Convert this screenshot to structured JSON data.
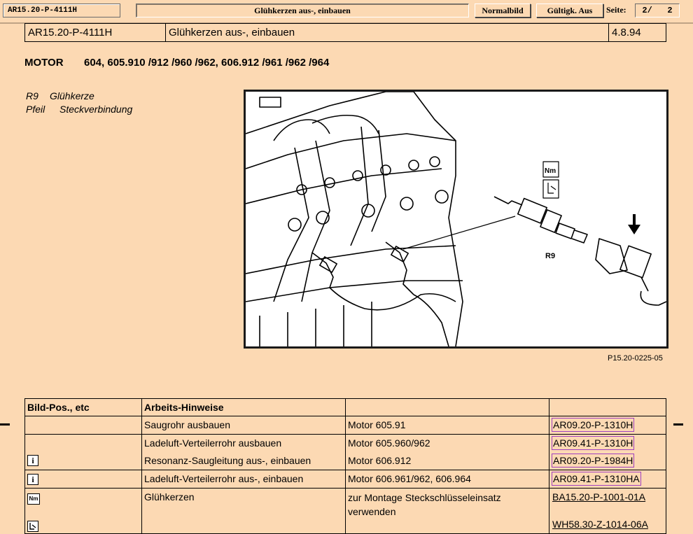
{
  "toolbar": {
    "doc_code": "AR15.20-P-4111H",
    "title": "Glühkerzen aus-, einbauen",
    "normal_button": "Normalbild",
    "validity_button": "Gültigk. Aus",
    "page_label": "Seite:",
    "page_current": "2/",
    "page_total": "2"
  },
  "header": {
    "code": "AR15.20-P-4111H",
    "title": "Glühkerzen aus-, einbauen",
    "date": "4.8.94"
  },
  "motor": {
    "label": "MOTOR",
    "models": "604, 605.910 /912 /960 /962, 606.912 /961 /962 /964"
  },
  "legend": [
    {
      "key": "R9",
      "text": "Glühkerze"
    },
    {
      "key": "Pfeil",
      "text": "Steckverbindung"
    }
  ],
  "figure": {
    "callout": "R9",
    "nm_icon": "Nm",
    "reference": "P15.20-0225-05"
  },
  "table": {
    "headers": [
      "Bild-Pos., etc",
      "Arbeits-Hinweise",
      "",
      ""
    ],
    "rows": [
      {
        "icon": "",
        "task": "Saugrohr ausbauen",
        "cond": "Motor 605.91",
        "ref": "AR09.20-P-1310H"
      },
      {
        "icon": "",
        "task": "Ladeluft-Verteilerrohr ausbauen",
        "cond": "Motor 605.960/962",
        "ref": "AR09.41-P-1310H"
      },
      {
        "icon": "i",
        "task": "Resonanz-Saugleitung aus-, einbauen",
        "cond": "Motor 606.912",
        "ref": "AR09.20-P-1984H"
      },
      {
        "icon": "i",
        "task": "Ladeluft-Verteilerrohr aus-, einbauen",
        "cond": "Motor 606.961/962, 606.964",
        "ref": "AR09.41-P-1310HA"
      },
      {
        "icon": "Nm",
        "task": "Glühkerzen",
        "cond": "zur Montage Steckschlüsseleinsatz verwenden",
        "ref": "BA15.20-P-1001-01A",
        "ref2": "WH58.30-Z-1014-06A"
      }
    ],
    "icons": {
      "info": "info-icon",
      "torque": "torque-nm-icon",
      "tool": "tool-icon"
    }
  }
}
